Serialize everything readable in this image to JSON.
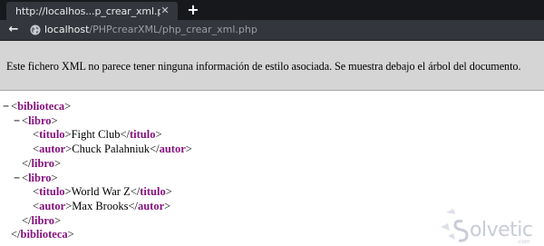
{
  "browser": {
    "tab_title": "http://localhos...p_crear_xml.php",
    "url_host": "localhost",
    "url_path": "/PHPcrearXML/php_crear_xml.php",
    "icons": {
      "tab_close": "close-icon",
      "new_tab": "plus-icon",
      "back": "back-arrow-icon",
      "site": "globe-icon"
    }
  },
  "banner": {
    "text": "Este fichero XML no parece tener ninguna información de estilo asociada. Se muestra debajo el árbol del documento."
  },
  "xml": {
    "collapse_marker": "−",
    "root_tag": "biblioteca",
    "books": [
      {
        "tag": "libro",
        "fields": [
          {
            "tag": "titulo",
            "value": "Fight Club"
          },
          {
            "tag": "autor",
            "value": "Chuck Palahniuk"
          }
        ]
      },
      {
        "tag": "libro",
        "fields": [
          {
            "tag": "titulo",
            "value": "World War Z"
          },
          {
            "tag": "autor",
            "value": "Max Brooks"
          }
        ]
      }
    ]
  },
  "watermark": {
    "brand": "olvetic",
    "domain": ".com"
  },
  "colors": {
    "tag": "#881280",
    "banner_bg": "#d5d5d5",
    "chrome_dark": "#16181c",
    "chrome_mid": "#33373d"
  }
}
